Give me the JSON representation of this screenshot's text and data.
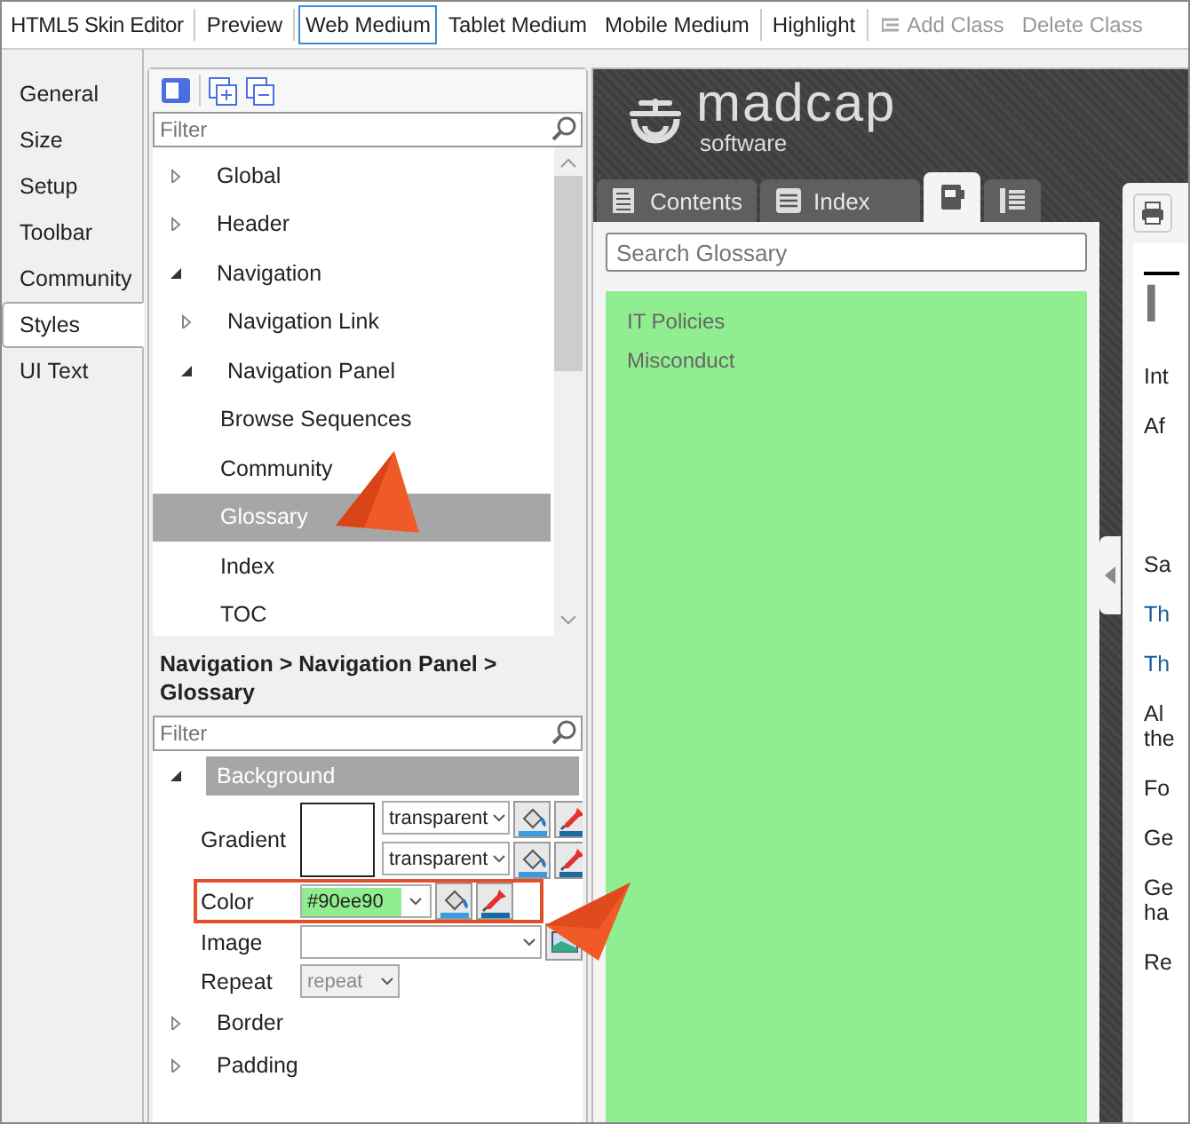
{
  "toolbar": {
    "title": "HTML5 Skin Editor",
    "preview": "Preview",
    "devices": [
      {
        "label": "Web Medium",
        "selected": true
      },
      {
        "label": "Tablet Medium",
        "selected": false
      },
      {
        "label": "Mobile Medium",
        "selected": false
      }
    ],
    "highlight": "Highlight",
    "actions": [
      {
        "label": "Add Class",
        "disabled": true
      },
      {
        "label": "Delete Class",
        "disabled": true
      }
    ]
  },
  "side_tabs": [
    {
      "label": "General",
      "selected": false
    },
    {
      "label": "Size",
      "selected": false
    },
    {
      "label": "Setup",
      "selected": false
    },
    {
      "label": "Toolbar",
      "selected": false
    },
    {
      "label": "Community",
      "selected": false
    },
    {
      "label": "Styles",
      "selected": true
    },
    {
      "label": "UI Text",
      "selected": false
    }
  ],
  "tree": {
    "filter_placeholder": "Filter",
    "items": [
      {
        "label": "Global",
        "expanded": false,
        "selected": false
      },
      {
        "label": "Header",
        "expanded": false,
        "selected": false
      },
      {
        "label": "Navigation",
        "expanded": true,
        "selected": false,
        "children": [
          {
            "label": "Navigation Link",
            "expanded": false,
            "selected": false
          },
          {
            "label": "Navigation Panel",
            "expanded": true,
            "selected": false,
            "children": [
              {
                "label": "Browse Sequences",
                "selected": false
              },
              {
                "label": "Community",
                "selected": false
              },
              {
                "label": "Glossary",
                "selected": true
              },
              {
                "label": "Index",
                "selected": false
              },
              {
                "label": "TOC",
                "selected": false
              }
            ]
          }
        ]
      }
    ]
  },
  "breadcrumb": "Navigation > Navigation Panel > Glossary",
  "properties": {
    "filter_placeholder": "Filter",
    "groups": [
      {
        "label": "Background",
        "expanded": true,
        "rows": [
          {
            "kind": "gradient",
            "label": "Gradient",
            "values": [
              "transparent",
              "transparent"
            ]
          },
          {
            "kind": "color",
            "label": "Color",
            "value": "#90ee90",
            "highlighted": true
          },
          {
            "kind": "image",
            "label": "Image"
          },
          {
            "kind": "select",
            "label": "Repeat",
            "value": "repeat",
            "disabled": true
          }
        ]
      },
      {
        "label": "Border",
        "expanded": false
      },
      {
        "label": "Padding",
        "expanded": false
      }
    ]
  },
  "preview": {
    "logo": "madcap",
    "logo_sub": "software",
    "tabs": [
      {
        "kind": "text",
        "label": "Contents",
        "selected": false
      },
      {
        "kind": "text",
        "label": "Index",
        "selected": false
      },
      {
        "kind": "icon",
        "selected": true
      },
      {
        "kind": "icon",
        "selected": false
      }
    ],
    "search_placeholder": "Search Glossary",
    "terms": [
      "IT Policies",
      "Misconduct"
    ],
    "heading": "I",
    "lines": [
      {
        "text": "Int",
        "link": false
      },
      {
        "text": "Af",
        "link": false
      },
      {
        "text": "Sa",
        "link": false
      },
      {
        "text": "Th",
        "link": true
      },
      {
        "text": "Th",
        "link": true
      },
      {
        "text": "Al\nthe",
        "link": false
      },
      {
        "text": "Fo",
        "link": false
      },
      {
        "text": "Ge",
        "link": false
      },
      {
        "text": "Ge\nha",
        "link": false
      },
      {
        "text": "Re",
        "link": false
      }
    ]
  }
}
